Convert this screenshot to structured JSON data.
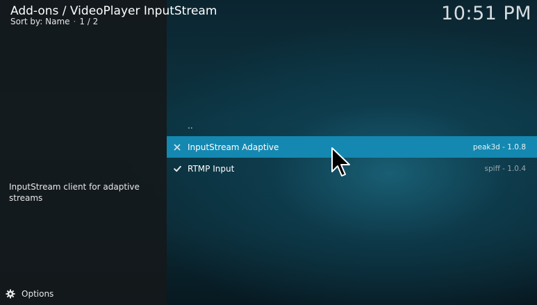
{
  "header": {
    "title": "Add-ons / VideoPlayer InputStream",
    "sort_label": "Sort by: Name",
    "sort_separator": "·",
    "page_indicator": "1 / 2"
  },
  "clock": "10:51 PM",
  "details": {
    "description": "InputStream client for adaptive streams"
  },
  "footer": {
    "options_label": "Options",
    "options_icon": "gear-icon"
  },
  "list": {
    "parent_label": "..",
    "items": [
      {
        "name": "InputStream Adaptive",
        "meta": "peak3d - 1.0.8",
        "status_icon": "x-icon",
        "selected": true
      },
      {
        "name": "RTMP Input",
        "meta": "spiff - 1.0.4",
        "status_icon": "check-icon",
        "selected": false
      }
    ]
  },
  "colors": {
    "selected_row": "#1488b0",
    "left_panel": "#14181a"
  }
}
